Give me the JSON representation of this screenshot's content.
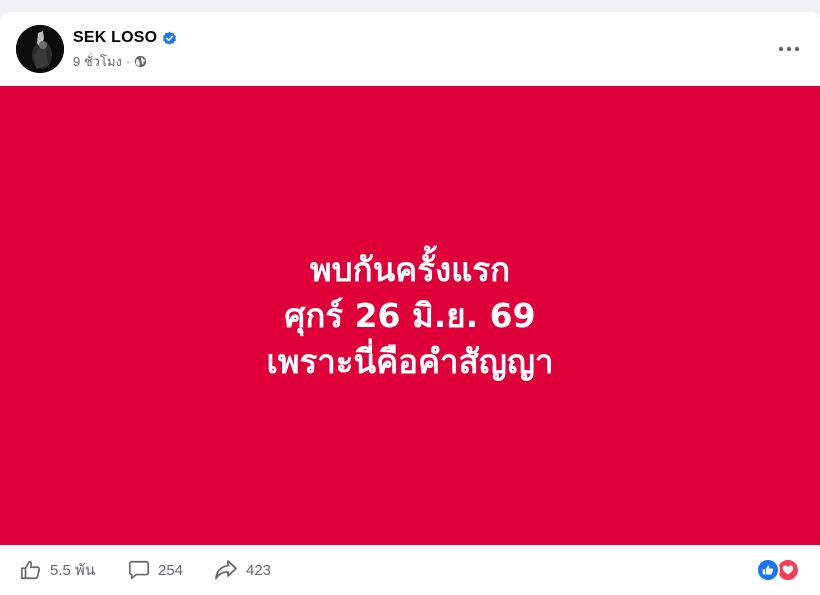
{
  "post": {
    "author": "SEK LOSO",
    "verified_icon": "verified-badge-icon",
    "time": "9 ชั่วโมง",
    "separator": "·",
    "audience_icon": "globe-icon",
    "menu_icon": "more-options-icon"
  },
  "banner": {
    "background": "#df0039",
    "text_color": "#ffffff",
    "lines": [
      "พบกันครั้งแรก",
      "ศุกร์ 26 มิ.ย. 69",
      "เพราะนี่คือคำสัญญา"
    ]
  },
  "stats": {
    "likes": "5.5 พัน",
    "comments": "254",
    "shares": "423",
    "like_icon": "thumbs-up-icon",
    "comment_icon": "comment-icon",
    "share_icon": "share-icon",
    "reaction_icons": [
      "like-reaction-icon",
      "love-reaction-icon"
    ]
  },
  "colors": {
    "brand_blue": "#1877f2",
    "love_red": "#f33e58",
    "secondary_text": "#65676b",
    "page_bg": "#f0f2f5"
  }
}
